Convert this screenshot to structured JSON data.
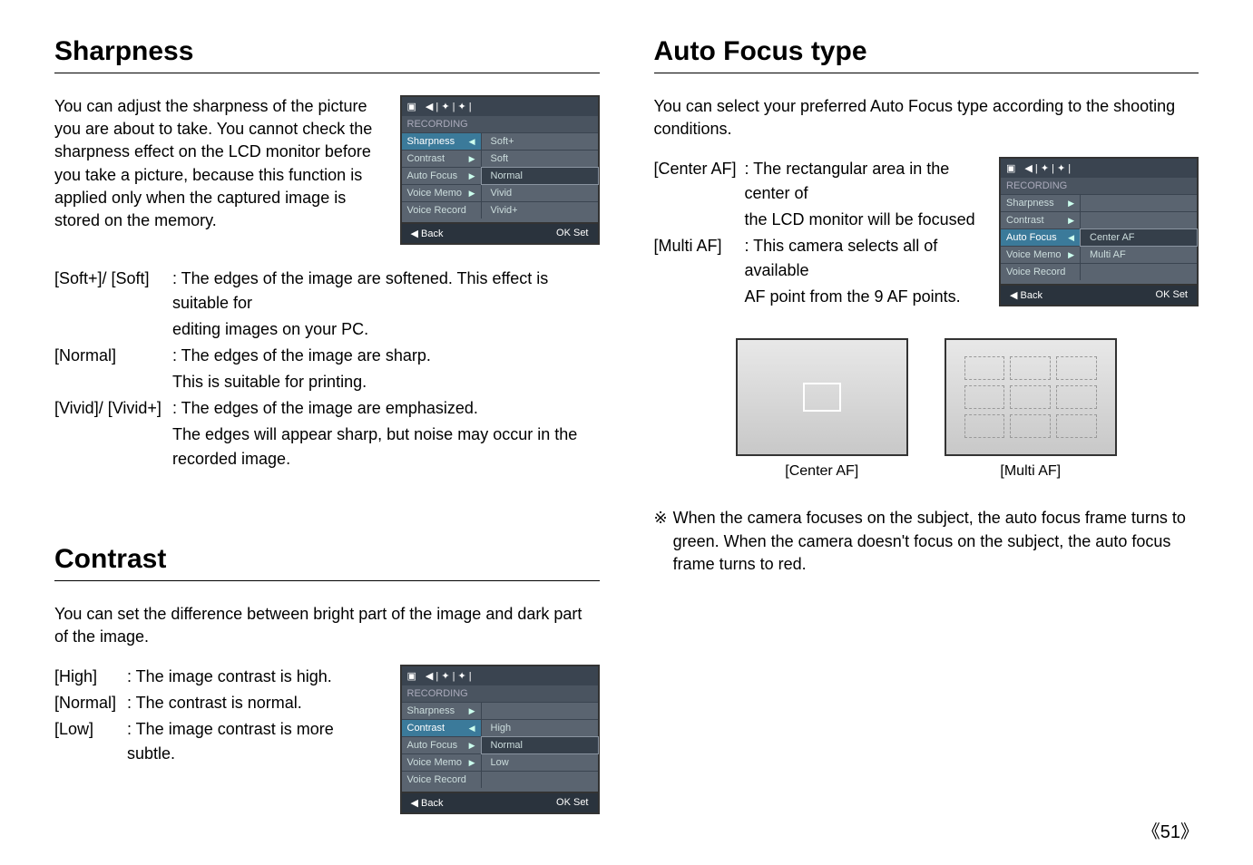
{
  "left": {
    "sharpness": {
      "title": "Sharpness",
      "intro": "You can adjust the sharpness of the picture you are about to take. You cannot check the sharpness effect on the LCD monitor before you take a picture, because this function is applied only when the captured image is stored on the memory.",
      "defs": [
        {
          "term": "[Soft+]/ [Soft]",
          "desc1": ": The edges of the image are softened. This effect is suitable for",
          "desc2": "editing images on your PC."
        },
        {
          "term": "[Normal]",
          "desc1": ": The edges of the image are sharp.",
          "desc2": "This is suitable for printing."
        },
        {
          "term": "[Vivid]/ [Vivid+]",
          "desc1": ": The edges of the image are emphasized.",
          "desc2": "The edges will appear sharp, but noise may occur in the recorded image."
        }
      ],
      "menu": {
        "title": "RECORDING",
        "rows": [
          {
            "l": "Sharpness",
            "r": "Soft+",
            "hl": true,
            "arrow": "◀"
          },
          {
            "l": "Contrast",
            "r": "Soft",
            "arrow": "▶"
          },
          {
            "l": "Auto Focus",
            "r": "Normal",
            "sel": true,
            "arrow": "▶"
          },
          {
            "l": "Voice Memo",
            "r": "Vivid",
            "arrow": "▶"
          },
          {
            "l": "Voice Record",
            "r": "Vivid+"
          }
        ],
        "back": "◀  Back",
        "ok": "OK  Set"
      }
    },
    "contrast": {
      "title": "Contrast",
      "intro": "You can set the difference between bright part of the image and dark part of the image.",
      "defs": [
        {
          "term": "[High]",
          "desc": ": The image contrast is high."
        },
        {
          "term": "[Normal]",
          "desc": ": The contrast is normal."
        },
        {
          "term": "[Low]",
          "desc": ": The image contrast is more subtle."
        }
      ],
      "menu": {
        "title": "RECORDING",
        "rows": [
          {
            "l": "Sharpness",
            "r": "",
            "arrow": "▶"
          },
          {
            "l": "Contrast",
            "r": "High",
            "hl": true,
            "arrow": "◀"
          },
          {
            "l": "Auto Focus",
            "r": "Normal",
            "sel": true,
            "arrow": "▶"
          },
          {
            "l": "Voice Memo",
            "r": "Low",
            "arrow": "▶"
          },
          {
            "l": "Voice Record",
            "r": ""
          }
        ],
        "back": "◀  Back",
        "ok": "OK  Set"
      }
    }
  },
  "right": {
    "af": {
      "title": "Auto Focus type",
      "intro": "You can select your preferred Auto Focus type according to the shooting conditions.",
      "defs": [
        {
          "term": "[Center AF]",
          "desc1": ": The rectangular area in the center of",
          "desc2": "the LCD monitor will be focused"
        },
        {
          "term": "[Multi AF]",
          "desc1": ": This camera selects all of available",
          "desc2": "AF point from the 9 AF points."
        }
      ],
      "menu": {
        "title": "RECORDING",
        "rows": [
          {
            "l": "Sharpness",
            "r": "",
            "arrow": "▶"
          },
          {
            "l": "Contrast",
            "r": "",
            "arrow": "▶"
          },
          {
            "l": "Auto Focus",
            "r": "Center AF",
            "hl": true,
            "sel": true,
            "arrow": "◀"
          },
          {
            "l": "Voice Memo",
            "r": "Multi AF",
            "arrow": "▶"
          },
          {
            "l": "Voice Record",
            "r": ""
          }
        ],
        "back": "◀  Back",
        "ok": "OK  Set"
      },
      "captionCenter": "[Center AF]",
      "captionMulti": "[Multi AF]",
      "noteSym": "※",
      "note": "When the camera focuses on the subject, the auto focus frame turns to green. When the camera doesn't focus on the subject, the auto focus frame turns to red."
    }
  },
  "pageNum": "51"
}
